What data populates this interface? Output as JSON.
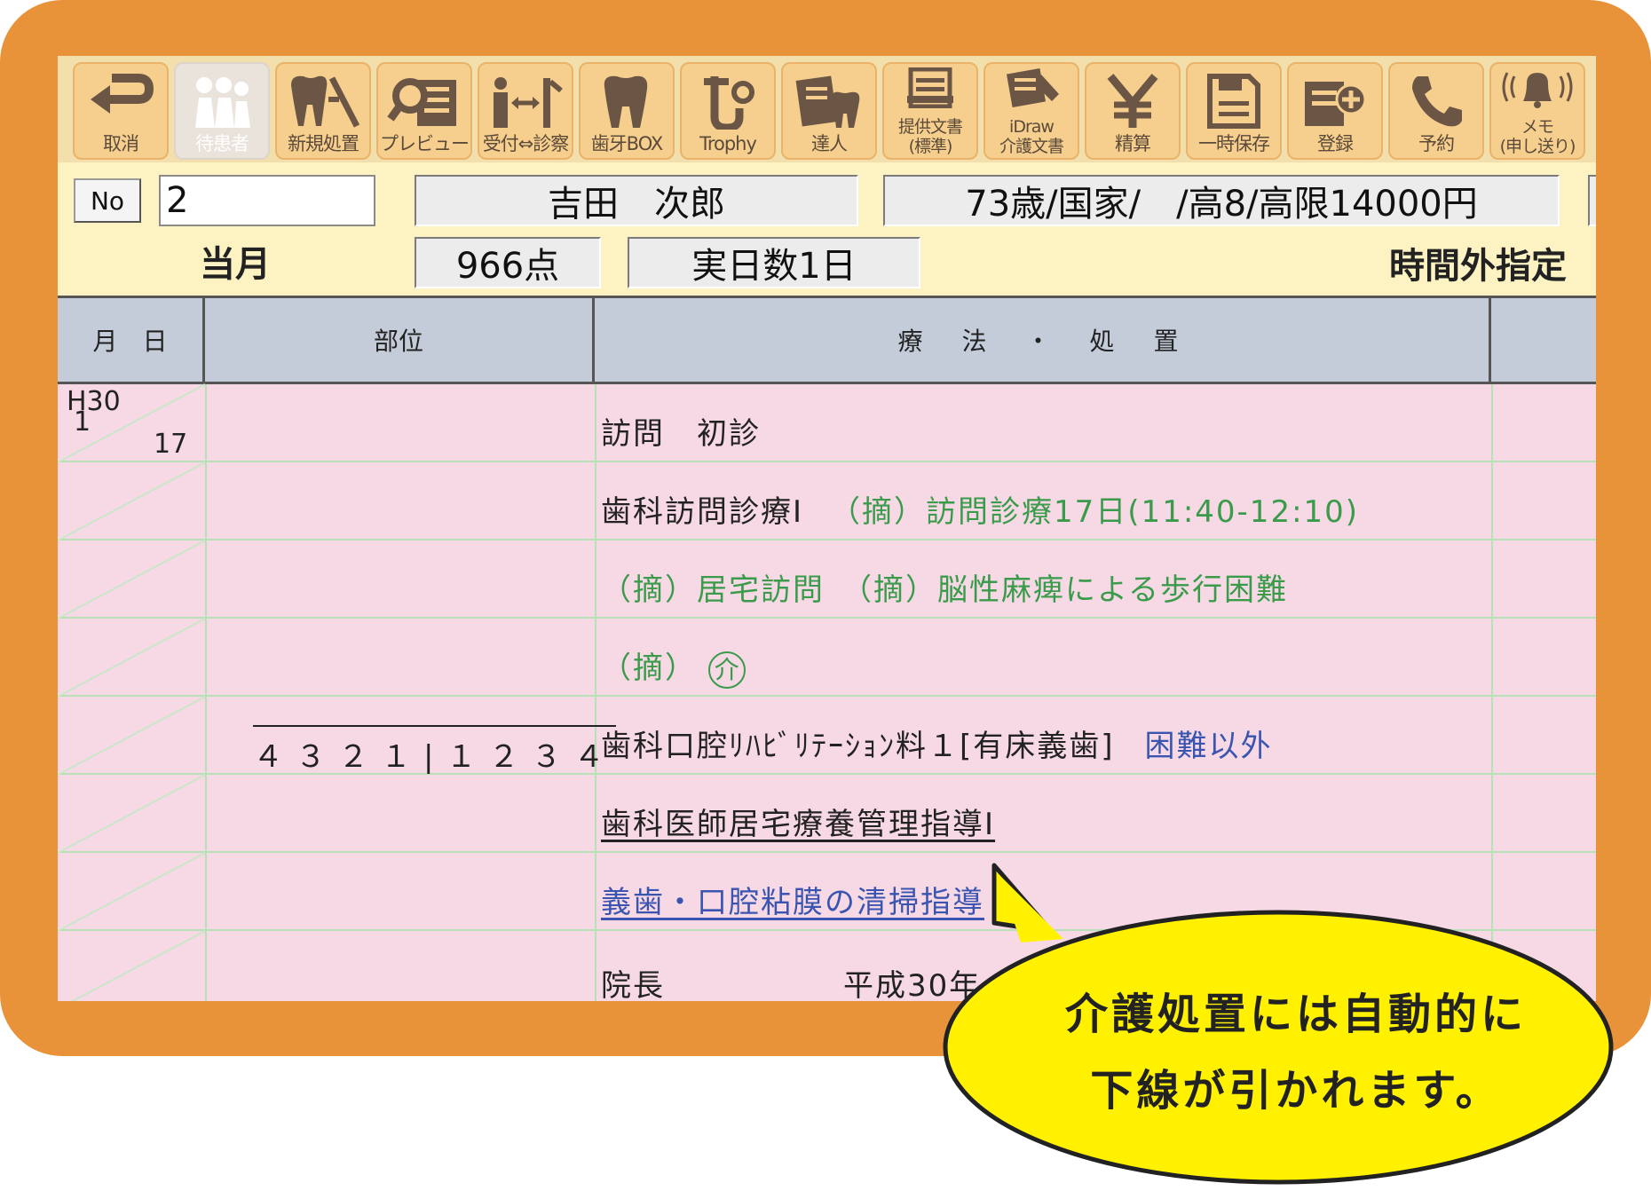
{
  "toolbar": {
    "buttons": [
      {
        "label": "取消",
        "icon": "undo-arrow-icon"
      },
      {
        "label": "待患者",
        "icon": "waiting-patients-icon",
        "disabled": true
      },
      {
        "label": "新規処置",
        "icon": "tooth-tool-icon"
      },
      {
        "label": "プレビュー",
        "icon": "preview-magnifier-icon"
      },
      {
        "label": "受付⇔診察",
        "icon": "reception-swap-icon"
      },
      {
        "label": "歯牙BOX",
        "icon": "tooth-icon"
      },
      {
        "label": "Trophy",
        "icon": "trophy-camera-icon"
      },
      {
        "label": "達人",
        "icon": "expert-document-icon"
      },
      {
        "label": "提供文書\n(標準)",
        "icon": "document-icon"
      },
      {
        "label": "iDraw\n介護文書",
        "icon": "idraw-document-icon"
      },
      {
        "label": "精算",
        "icon": "yen-icon"
      },
      {
        "label": "一時保存",
        "icon": "save-floppy-icon"
      },
      {
        "label": "登録",
        "icon": "register-plus-icon"
      },
      {
        "label": "予約",
        "icon": "phone-icon"
      },
      {
        "label": "メモ\n(申し送り)",
        "icon": "bell-icon"
      }
    ]
  },
  "header": {
    "no_label": "No",
    "no_value": "2",
    "patient_name": "吉田　次郎",
    "patient_info": "73歳/国家/　/高8/高限14000円",
    "month_label": "当月",
    "points": "966点",
    "days": "実日数1日",
    "overtime": "時間外指定"
  },
  "table": {
    "headers": {
      "date": "月　日",
      "site": "部位",
      "treatment": "療　法　・　処　置"
    },
    "date_era": "H30",
    "date_month": "1",
    "date_day": "17",
    "teeth": "４３２１|１２３４",
    "rows": [
      {
        "text": "訪問　初診"
      },
      {
        "text": "歯科訪問診療Ⅰ",
        "note": "（摘）訪問診療17日(11:40-12:10)"
      },
      {
        "note": "（摘）居宅訪問　（摘）脳性麻痺による歩行困難"
      },
      {
        "note": "（摘）",
        "mark": "介"
      },
      {
        "text": "歯科口腔ﾘﾊﾋﾞﾘﾃｰｼｮﾝ料１[有床義歯]",
        "note_blue": "困難以外"
      },
      {
        "text": "歯科医師居宅療養管理指導Ⅰ"
      },
      {
        "text_blue": "義歯・口腔粘膜の清掃指導"
      },
      {
        "text": "院長",
        "signature_date": "平成30年"
      }
    ]
  },
  "callout": {
    "line1": "介護処置には自動的に",
    "line2": "下線が引かれます。"
  }
}
